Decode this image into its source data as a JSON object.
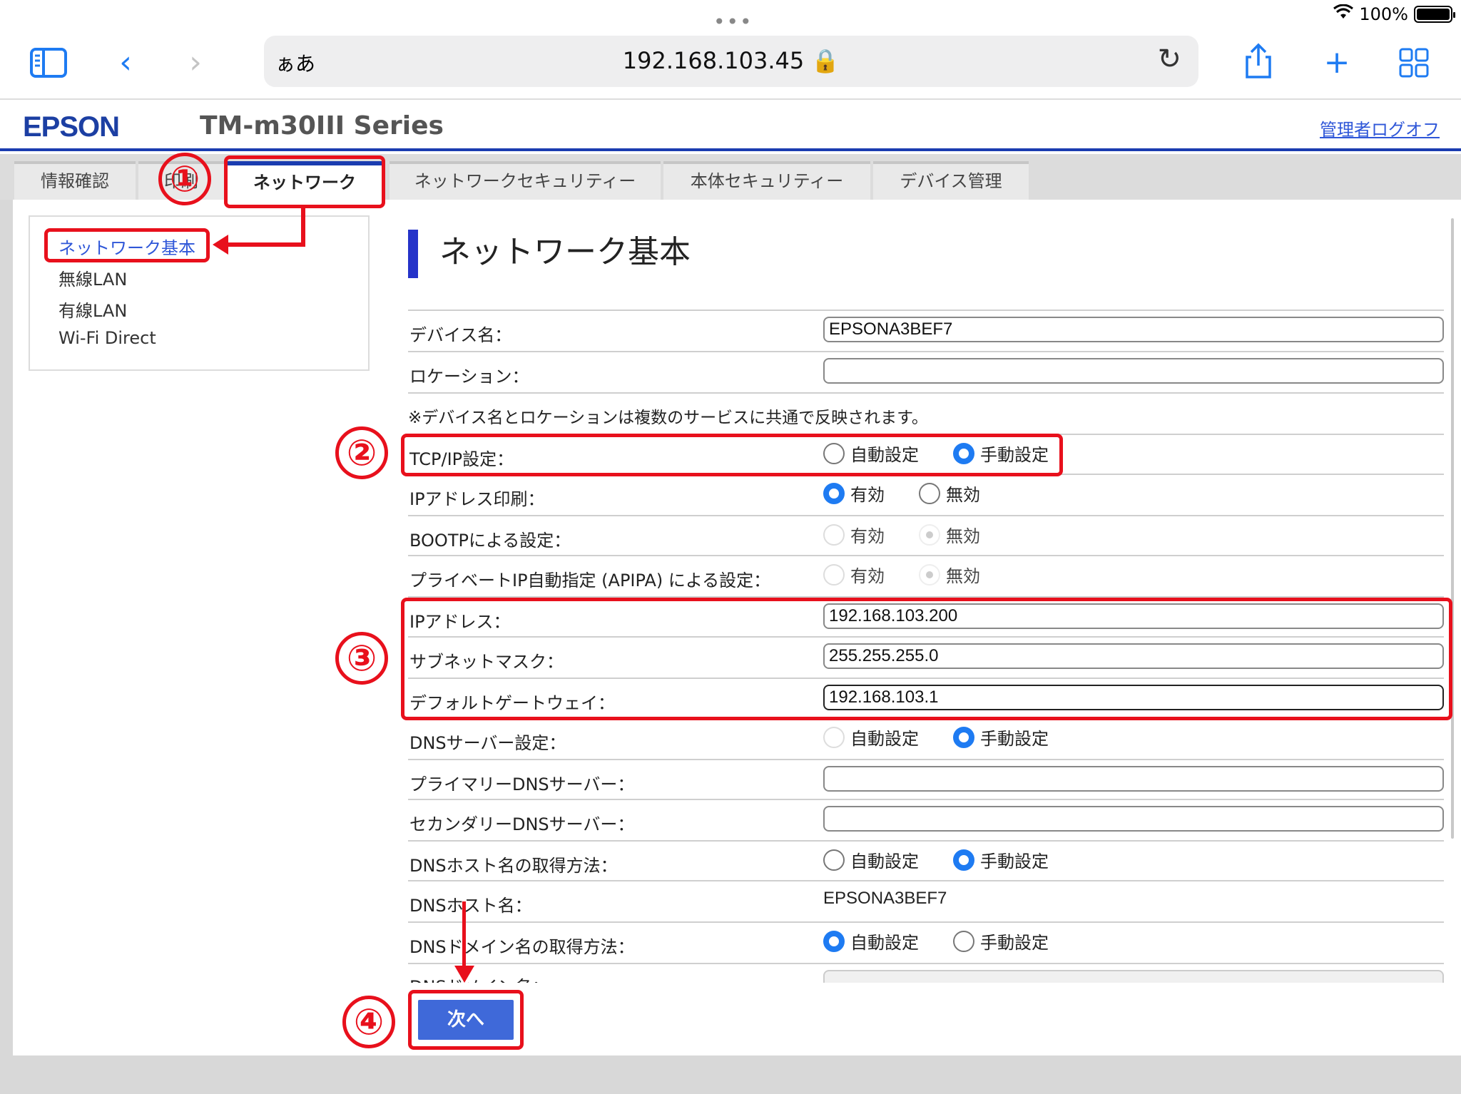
{
  "status": {
    "battery": "100%"
  },
  "browser": {
    "reader_label": "ぁあ",
    "url": "192.168.103.45 🔒"
  },
  "header": {
    "brand": "EPSON",
    "model": "TM-m30III Series",
    "logoff": "管理者ログオフ"
  },
  "tabs": [
    {
      "label": "情報確認"
    },
    {
      "label": "印刷"
    },
    {
      "label": "ネットワーク"
    },
    {
      "label": "ネットワークセキュリティー"
    },
    {
      "label": "本体セキュリティー"
    },
    {
      "label": "デバイス管理"
    }
  ],
  "sidebar": {
    "items": [
      {
        "label": "ネットワーク基本"
      },
      {
        "label": "無線LAN"
      },
      {
        "label": "有線LAN"
      },
      {
        "label": "Wi-Fi Direct"
      }
    ]
  },
  "page_title": "ネットワーク基本",
  "form": {
    "device_name": {
      "label": "デバイス名：",
      "value": "EPSONA3BEF7"
    },
    "location": {
      "label": "ロケーション：",
      "value": ""
    },
    "note": "※デバイス名とロケーションは複数のサービスに共通で反映されます。",
    "tcpip": {
      "label": "TCP/IP設定：",
      "opt1": "自動設定",
      "opt2": "手動設定",
      "selected": "手動設定"
    },
    "ip_print": {
      "label": "IPアドレス印刷：",
      "opt1": "有効",
      "opt2": "無効",
      "selected": "有効"
    },
    "bootp": {
      "label": "BOOTPによる設定：",
      "opt1": "有効",
      "opt2": "無効",
      "selected": "無効"
    },
    "apipa": {
      "label": "プライベートIP自動指定 (APIPA) による設定：",
      "opt1": "有効",
      "opt2": "無効",
      "selected": "無効"
    },
    "ip_address": {
      "label": "IPアドレス：",
      "value": "192.168.103.200"
    },
    "subnet": {
      "label": "サブネットマスク：",
      "value": "255.255.255.0"
    },
    "gateway": {
      "label": "デフォルトゲートウェイ：",
      "value": "192.168.103.1"
    },
    "dns_setting": {
      "label": "DNSサーバー設定：",
      "opt1": "自動設定",
      "opt2": "手動設定",
      "selected": "手動設定"
    },
    "primary_dns": {
      "label": "プライマリーDNSサーバー：",
      "value": ""
    },
    "secondary_dns": {
      "label": "セカンダリーDNSサーバー：",
      "value": ""
    },
    "dns_host_method": {
      "label": "DNSホスト名の取得方法：",
      "opt1": "自動設定",
      "opt2": "手動設定",
      "selected": "手動設定"
    },
    "dns_host": {
      "label": "DNSホスト名：",
      "value": "EPSONA3BEF7"
    },
    "dns_domain_method": {
      "label": "DNSドメイン名の取得方法：",
      "opt1": "自動設定",
      "opt2": "手動設定",
      "selected": "自動設定"
    },
    "dns_domain": {
      "label": "DNSドメイン名：",
      "value": ""
    }
  },
  "next_button": "次へ",
  "annotations": [
    "①",
    "②",
    "③",
    "④"
  ],
  "colors": {
    "accent": "#1a3cb0",
    "annotation": "#e8101c",
    "button": "#3f69d9",
    "link": "#2f57d8"
  }
}
